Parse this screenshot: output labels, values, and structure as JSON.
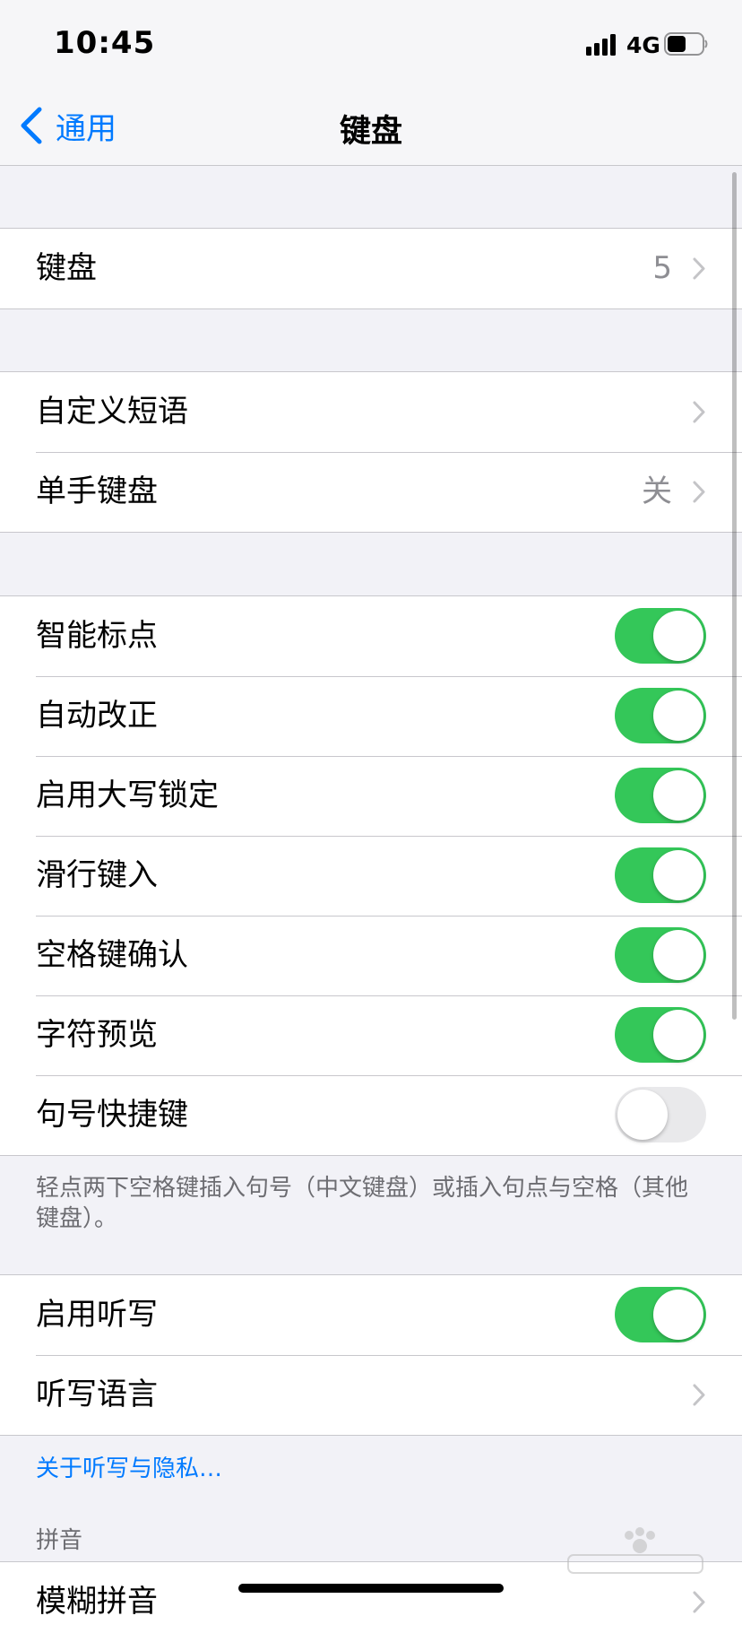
{
  "status_bar": {
    "time": "10:45",
    "network": "4G"
  },
  "nav": {
    "back_label": "通用",
    "title": "键盘"
  },
  "groups": {
    "keyboards": {
      "label": "键盘",
      "value": "5"
    },
    "text": {
      "text_replacement": {
        "label": "自定义短语"
      },
      "one_handed": {
        "label": "单手键盘",
        "value": "关"
      }
    },
    "toggles": [
      {
        "label": "智能标点",
        "on": true
      },
      {
        "label": "自动改正",
        "on": true
      },
      {
        "label": "启用大写锁定",
        "on": true
      },
      {
        "label": "滑行键入",
        "on": true
      },
      {
        "label": "空格键确认",
        "on": true
      },
      {
        "label": "字符预览",
        "on": true
      },
      {
        "label": "句号快捷键",
        "on": false
      }
    ],
    "toggles_footer": "轻点两下空格键插入句号（中文键盘）或插入句点与空格（其他键盘）。",
    "dictation": {
      "enable": {
        "label": "启用听写",
        "on": true
      },
      "languages": {
        "label": "听写语言"
      }
    },
    "dictation_link": "关于听写与隐私…",
    "pinyin": {
      "header": "拼音",
      "fuzzy": {
        "label": "模糊拼音"
      }
    }
  },
  "colors": {
    "accent": "#007aff",
    "toggle_on": "#34c759",
    "toggle_off": "#e9e9eb",
    "background": "#f2f2f7"
  }
}
